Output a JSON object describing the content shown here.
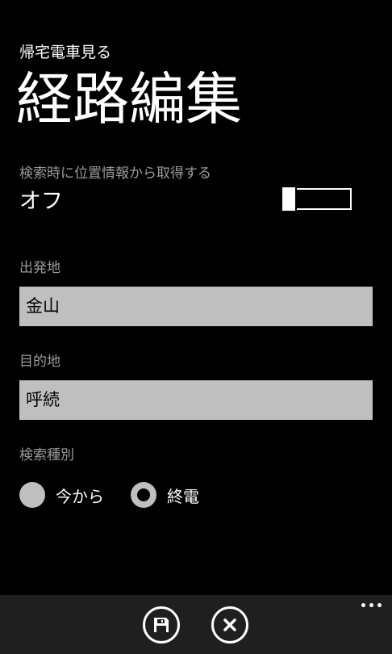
{
  "header": {
    "app_title": "帰宅電車見る",
    "page_title": "経路編集"
  },
  "location_setting": {
    "label": "検索時に位置情報から取得する",
    "state": "オフ",
    "enabled": false
  },
  "departure": {
    "label": "出発地",
    "value": "金山"
  },
  "destination": {
    "label": "目的地",
    "value": "呼続"
  },
  "search_type": {
    "label": "検索種別",
    "options": [
      {
        "label": "今から",
        "selected": false
      },
      {
        "label": "終電",
        "selected": true
      }
    ]
  },
  "app_bar": {
    "buttons": [
      {
        "icon": "save-icon"
      },
      {
        "icon": "cancel-icon"
      }
    ],
    "more": "ellipsis-icon"
  },
  "colors": {
    "background": "#000000",
    "field": "#bfbfbf",
    "label": "#9a9a9a",
    "app_bar": "#1f1f1f"
  }
}
